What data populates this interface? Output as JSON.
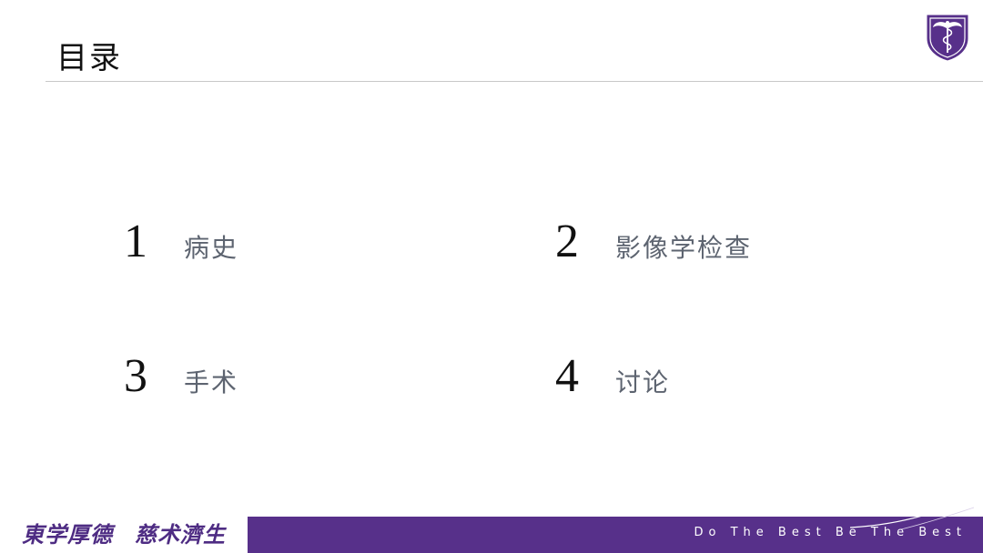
{
  "header": {
    "title": "目录"
  },
  "toc": [
    {
      "number": "1",
      "label": "病史"
    },
    {
      "number": "2",
      "label": "影像学检查"
    },
    {
      "number": "3",
      "label": "手术"
    },
    {
      "number": "4",
      "label": "讨论"
    }
  ],
  "footer": {
    "motto_left": "東学厚德",
    "motto_right": "慈术濟生",
    "slogan": "Do The Best   Be The Best"
  },
  "colors": {
    "brand_purple": "#57308a",
    "label_gray": "#5d6470"
  },
  "icons": {
    "logo": "university-shield-caduceus-icon"
  }
}
